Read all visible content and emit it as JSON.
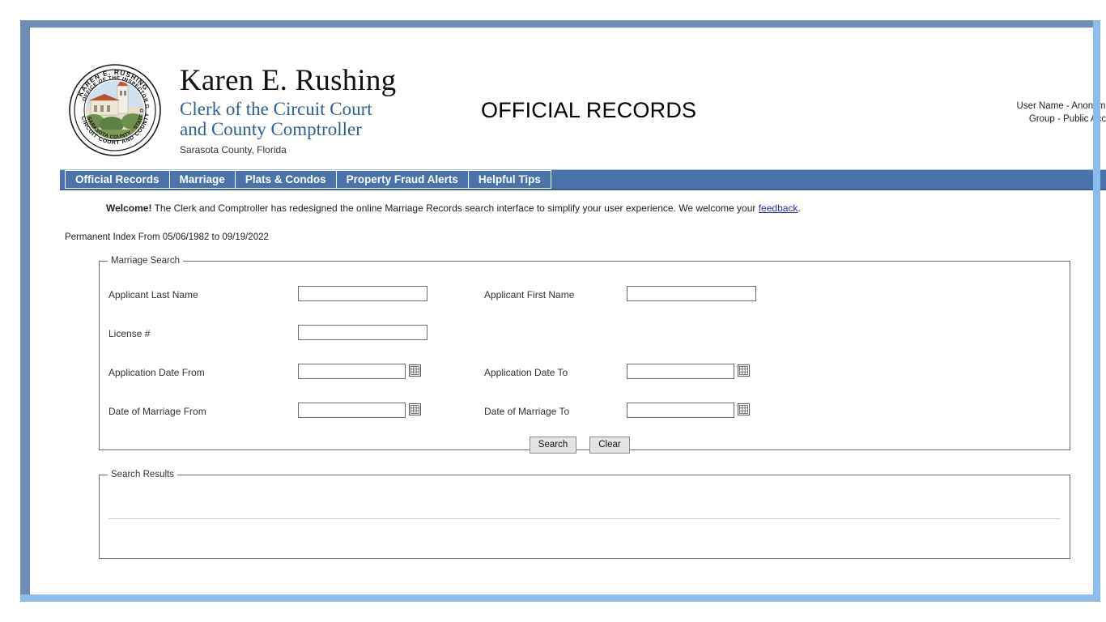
{
  "header": {
    "seal_alt": "seal-sarasota-county-clerk",
    "org_name": "Karen E. Rushing",
    "org_role_line1": "Clerk of the Circuit Court",
    "org_role_line2": "and County Comptroller",
    "org_place": "Sarasota County, Florida",
    "page_title": "OFFICIAL RECORDS",
    "user_name": "User Name - Anonymous",
    "group": "Group - Public Access"
  },
  "nav": {
    "items": [
      {
        "label": "Official Records"
      },
      {
        "label": "Marriage"
      },
      {
        "label": "Plats & Condos"
      },
      {
        "label": "Property Fraud Alerts"
      },
      {
        "label": "Helpful Tips"
      }
    ]
  },
  "welcome": {
    "bold_prefix": "Welcome!",
    "body": " The Clerk and Comptroller has redesigned the online Marriage Records search interface to simplify your user experience. We welcome your ",
    "link_label": "feedback",
    "suffix": "."
  },
  "permanent_index": "Permanent Index From 05/06/1982 to 09/19/2022",
  "search_form": {
    "legend": "Marriage Search",
    "fields": {
      "applicant_last_name": {
        "label": "Applicant Last Name",
        "value": "",
        "placeholder": ""
      },
      "applicant_first_name": {
        "label": "Applicant First Name",
        "value": "",
        "placeholder": ""
      },
      "license_number": {
        "label": "License #",
        "value": "",
        "placeholder": ""
      },
      "application_date_from": {
        "label": "Application Date From",
        "value": "",
        "placeholder": ""
      },
      "application_date_to": {
        "label": "Application Date To",
        "value": "",
        "placeholder": ""
      },
      "date_of_marriage_from": {
        "label": "Date of Marriage From",
        "value": "",
        "placeholder": ""
      },
      "date_of_marriage_to": {
        "label": "Date of Marriage To",
        "value": "",
        "placeholder": ""
      }
    },
    "calendar_icon_name": "calendar-icon",
    "buttons": {
      "search": "Search",
      "clear": "Clear"
    }
  },
  "results": {
    "legend": "Search Results",
    "rows": []
  },
  "colors": {
    "nav_bar": "#4a72ab",
    "frame_border": "#6b8db8",
    "scrollbar": "#8dbbec",
    "org_role_blue": "#2f5f91",
    "link_blue": "#2a2ab0"
  }
}
